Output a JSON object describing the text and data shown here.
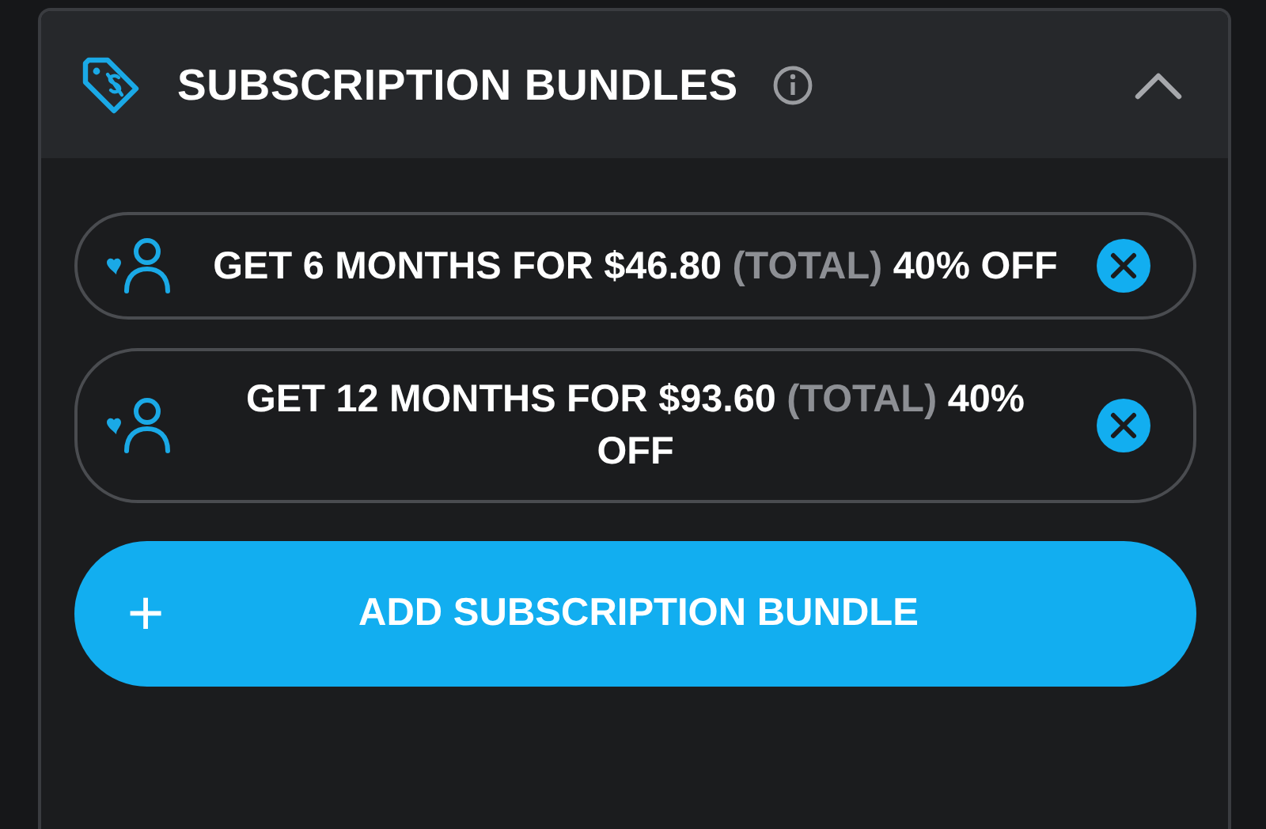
{
  "header": {
    "title": "SUBSCRIPTION BUNDLES",
    "expanded": true
  },
  "bundles": [
    {
      "text": "GET 6 MONTHS FOR $46.80",
      "note": "(TOTAL)",
      "discount": "40% OFF"
    },
    {
      "text": "GET 12 MONTHS FOR $93.60",
      "note": "(TOTAL)",
      "discount": "40% OFF"
    }
  ],
  "add_button": {
    "icon": "+",
    "label": "ADD SUBSCRIPTION BUNDLE"
  }
}
